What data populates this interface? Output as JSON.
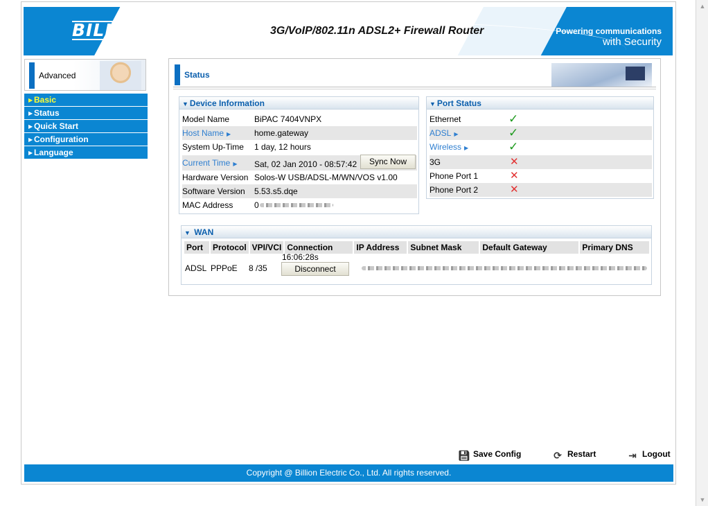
{
  "header": {
    "logo": "BILLION",
    "title": "3G/VoIP/802.11n ADSL2+ Firewall Router",
    "tagline_line1": "Powering communications",
    "tagline_line2": "with Security"
  },
  "sidebar": {
    "mode_label": "Advanced",
    "items": [
      {
        "label": "Basic",
        "active": true
      },
      {
        "label": "Status"
      },
      {
        "label": "Quick Start"
      },
      {
        "label": "Configuration"
      },
      {
        "label": "Language"
      }
    ]
  },
  "page": {
    "title": "Status"
  },
  "device_info": {
    "heading": "Device Information",
    "rows": [
      {
        "label": "Model Name",
        "value": "BiPAC 7404VNPX"
      },
      {
        "label": "Host Name",
        "value": "home.gateway"
      },
      {
        "label": "System Up-Time",
        "value": "1 day, 12 hours"
      },
      {
        "label": "Current Time",
        "value": "Sat, 02 Jan 2010 - 08:57:42"
      },
      {
        "label": "Hardware Version",
        "value": "Solos-W USB/ADSL-M/WN/VOS v1.00"
      },
      {
        "label": "Software Version",
        "value": "5.53.s5.dqe"
      },
      {
        "label": "MAC Address",
        "value": "0"
      }
    ],
    "sync_button": "Sync Now"
  },
  "port_status": {
    "heading": "Port Status",
    "ports": [
      {
        "name": "Ethernet",
        "state": "up"
      },
      {
        "name": "ADSL",
        "state": "up"
      },
      {
        "name": "Wireless",
        "state": "up"
      },
      {
        "name": "3G",
        "state": "down"
      },
      {
        "name": "Phone Port 1",
        "state": "down"
      },
      {
        "name": "Phone Port 2",
        "state": "down"
      }
    ]
  },
  "wan": {
    "heading": "WAN",
    "columns": [
      "Port",
      "Protocol",
      "VPI/VCI",
      "Connection",
      "IP Address",
      "Subnet Mask",
      "Default Gateway",
      "Primary DNS"
    ],
    "row": {
      "port": "ADSL",
      "protocol": "PPPoE",
      "vpi_vci": "8 /35",
      "connection_time": "16:06:28s"
    },
    "disconnect_button": "Disconnect"
  },
  "actions": {
    "save": "Save Config",
    "restart": "Restart",
    "logout": "Logout"
  },
  "footer": {
    "copyright": "Copyright @ Billion Electric Co., Ltd. All rights reserved."
  },
  "colors": {
    "brand_blue": "#0b86d2",
    "active_nav": "#ffff33",
    "link": "#2f7fd0"
  }
}
